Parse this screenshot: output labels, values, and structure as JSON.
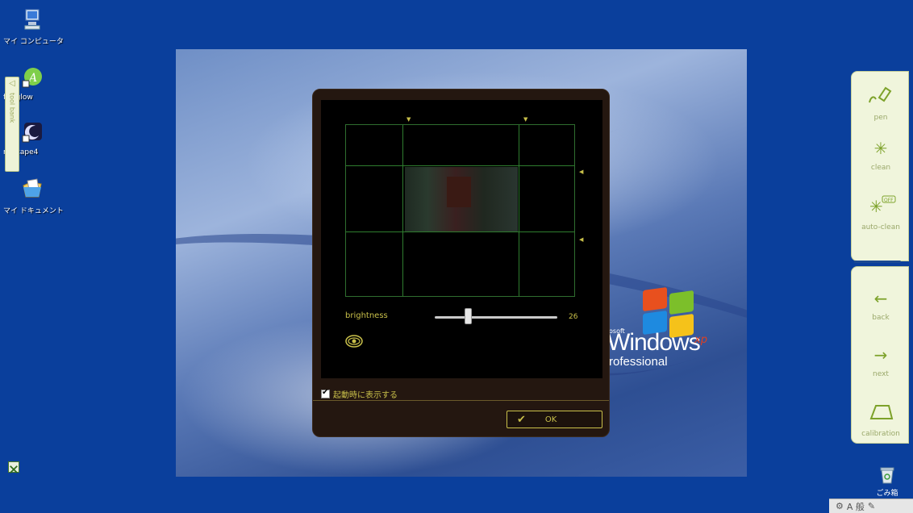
{
  "desktop": {
    "icons": [
      {
        "label": "マイ コンピュータ",
        "icon": "computer-icon"
      },
      {
        "label": "fterglow",
        "icon": "afterglow-icon"
      },
      {
        "label": "nascape4",
        "icon": "nascape-icon"
      },
      {
        "label": "マイ ドキュメント",
        "icon": "documents-folder-icon"
      }
    ],
    "recycle_bin": {
      "label": "ごみ箱",
      "icon": "recycle-bin-icon"
    },
    "wallpaper": {
      "soft": "osoft",
      "windows": "Windows",
      "xp": "xp",
      "edition": "rofessional"
    }
  },
  "tool_bank": {
    "label": "tool bank"
  },
  "dialog": {
    "brightness_label": "brightness",
    "brightness_value": "26",
    "brightness_level": 0.26,
    "show_on_startup_label": "起動時に表示する",
    "show_on_startup_checked": true,
    "ok_label": "OK"
  },
  "right_panel": {
    "tools": [
      {
        "label": "pen",
        "icon": "pen-icon"
      },
      {
        "label": "clean",
        "icon": "clean-icon"
      },
      {
        "label": "auto-clean",
        "icon": "auto-clean-icon"
      }
    ],
    "nav": [
      {
        "label": "back",
        "icon": "back-arrow-icon"
      },
      {
        "label": "next",
        "icon": "next-arrow-icon"
      },
      {
        "label": "calibration",
        "icon": "calibration-icon"
      }
    ]
  },
  "tray": {
    "ime": "A 般"
  },
  "colors": {
    "accent": "#c9c04a",
    "desktop": "#0a3f9c",
    "grid": "#2f7d2f",
    "panel": "#f0f5dc"
  }
}
